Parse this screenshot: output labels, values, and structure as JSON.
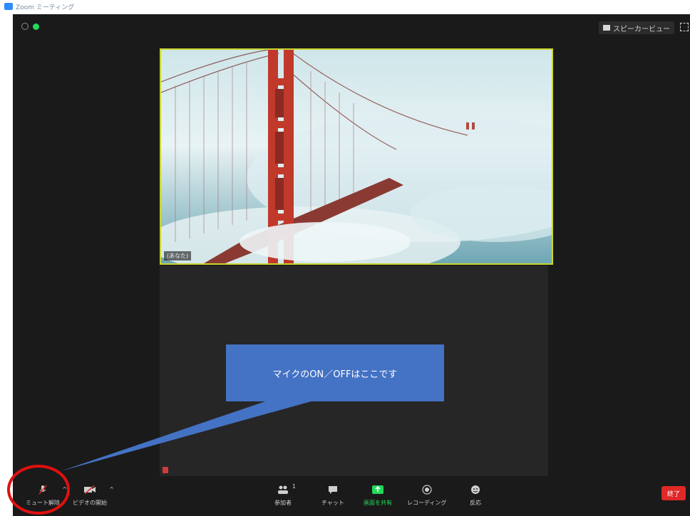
{
  "window": {
    "title": "Zoom ミーティング"
  },
  "header": {
    "speaker_view_label": "スピーカービュー"
  },
  "video": {
    "participant_name": "(あなた)"
  },
  "toolbar": {
    "mute_label": "ミュート解除",
    "video_label": "ビデオの開始",
    "participants_label": "参加者",
    "participants_count": "1",
    "chat_label": "チャット",
    "share_label": "画面を共有",
    "record_label": "レコーディング",
    "reactions_label": "反応",
    "end_label": "終了"
  },
  "annotation": {
    "callout_text": "マイクのON／OFFはここです"
  },
  "colors": {
    "accent_green": "#23d959",
    "end_red": "#e02828",
    "callout_blue": "#4472c4",
    "highlight_red": "#e01010"
  }
}
